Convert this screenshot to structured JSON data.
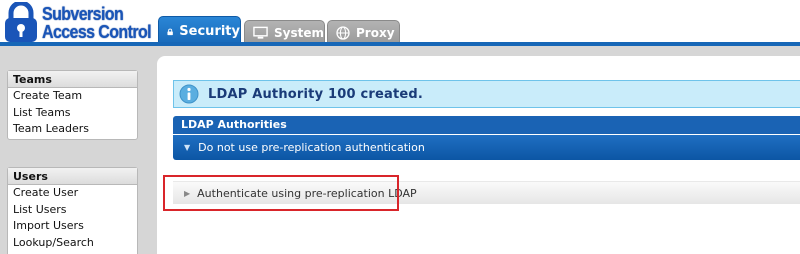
{
  "app": {
    "title_line1": "Subversion",
    "title_line2": "Access Control"
  },
  "tabs": [
    {
      "label": "Security",
      "icon": "lock-icon",
      "active": true
    },
    {
      "label": "System",
      "icon": "monitor-icon",
      "active": false
    },
    {
      "label": "Proxy",
      "icon": "globe-icon",
      "active": false
    }
  ],
  "sidebar": {
    "teams": {
      "title": "Teams",
      "items": [
        "Create Team",
        "List Teams",
        "Team Leaders"
      ]
    },
    "users": {
      "title": "Users",
      "items": [
        "Create User",
        "List Users",
        "Import Users",
        "Lookup/Search"
      ]
    }
  },
  "main": {
    "info_message": "LDAP Authority 100 created.",
    "ldap_panel": {
      "title": "LDAP Authorities",
      "option_selected": "Do not use pre-replication authentication",
      "option_other": "Authenticate using pre-replication LDAP"
    }
  },
  "colors": {
    "accent": "#1767b7",
    "info_bg": "#c9ecfa",
    "highlight": "#d9252a"
  }
}
